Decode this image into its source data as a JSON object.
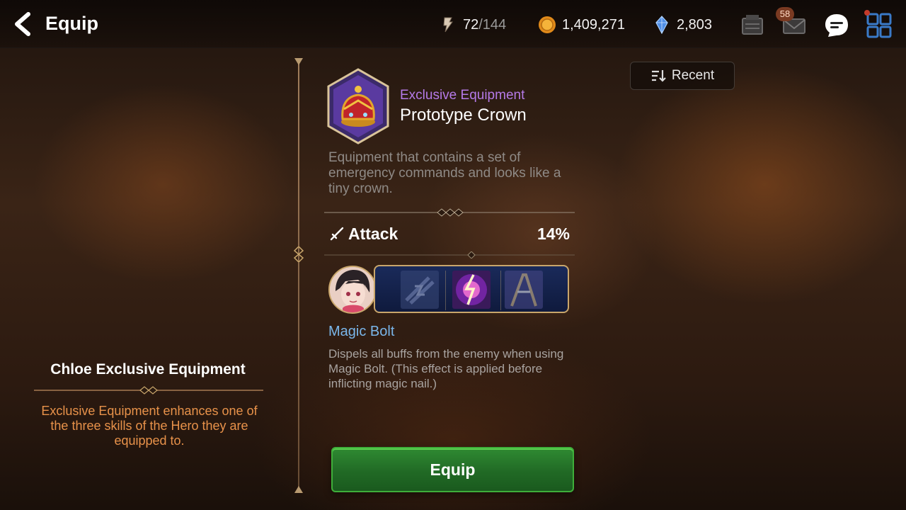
{
  "header": {
    "title": "Equip",
    "stamina": {
      "current": "72",
      "sep_max": "/144"
    },
    "gold": "1,409,271",
    "crystals": "2,803",
    "mail_badge": "58"
  },
  "sort": {
    "label": "Recent"
  },
  "left_panel": {
    "title": "Chloe Exclusive Equipment",
    "description": "Exclusive Equipment enhances one of the three skills of the Hero they are equipped to."
  },
  "item": {
    "type": "Exclusive Equipment",
    "name": "Prototype Crown",
    "description": "Equipment that contains a set of emergency commands and looks like a tiny crown.",
    "stat": {
      "name": "Attack",
      "value": "14%"
    }
  },
  "skill": {
    "name": "Magic Bolt",
    "description": "Dispels all buffs from the enemy when using Magic Bolt. (This effect is applied before inflicting magic nail.)"
  },
  "actions": {
    "equip_label": "Equip"
  },
  "colors": {
    "item_type": "#b57ae8",
    "skill_name": "#7ab6ea",
    "left_desc": "#e8924a",
    "equip_button": "#2f8a32",
    "frame_gold": "#c9a66b"
  },
  "icons": [
    "back-arrow-icon",
    "stamina-icon",
    "gold-coin-icon",
    "crystal-icon",
    "inventory-icon",
    "mail-icon",
    "chat-icon",
    "menu-grid-icon",
    "sort-icon",
    "sword-icon"
  ]
}
